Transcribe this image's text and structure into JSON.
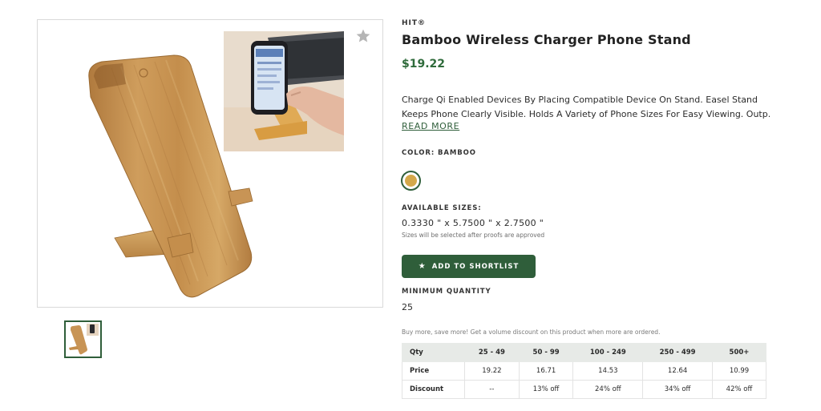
{
  "gallery": {
    "main_image_alt": "Bamboo phone stand",
    "favorite_icon": "star-icon",
    "thumbnail_alt": "Bamboo phone stand thumbnail"
  },
  "product": {
    "brand": "HIT®",
    "title": "Bamboo Wireless Charger Phone Stand",
    "price": "$19.22",
    "description_line1": "Charge Qi Enabled Devices By Placing Compatible Device On Stand. Easel Stand",
    "description_line2": "Keeps Phone Clearly Visible. Holds A Variety of Phone Sizes For Easy Viewing. Outp...",
    "read_more": "READ MORE"
  },
  "color": {
    "label": "COLOR: BAMBOO",
    "swatch_color": "#d4a84a",
    "selected": "BAMBOO"
  },
  "sizes": {
    "label": "AVAILABLE SIZES:",
    "value": "0.3330 \" x 5.7500 \" x 2.7500 \"",
    "note": "Sizes will be selected after proofs are approved"
  },
  "actions": {
    "shortlist_label": "ADD TO SHORTLIST",
    "shortlist_icon": "star-icon"
  },
  "minimum": {
    "label": "MINIMUM QUANTITY",
    "value": "25"
  },
  "volume": {
    "note": "Buy more, save more! Get a volume discount on this product when more are ordered.",
    "headers": [
      "Qty",
      "25 - 49",
      "50 - 99",
      "100 - 249",
      "250 - 499",
      "500+"
    ],
    "price_row": [
      "Price",
      "19.22",
      "16.71",
      "14.53",
      "12.64",
      "10.99"
    ],
    "discount_row": [
      "Discount",
      "--",
      "13% off",
      "24% off",
      "34% off",
      "42% off"
    ]
  },
  "colors": {
    "accent": "#2f5e3a",
    "price": "#2f6b3b",
    "table_header": "#e7eae7"
  }
}
